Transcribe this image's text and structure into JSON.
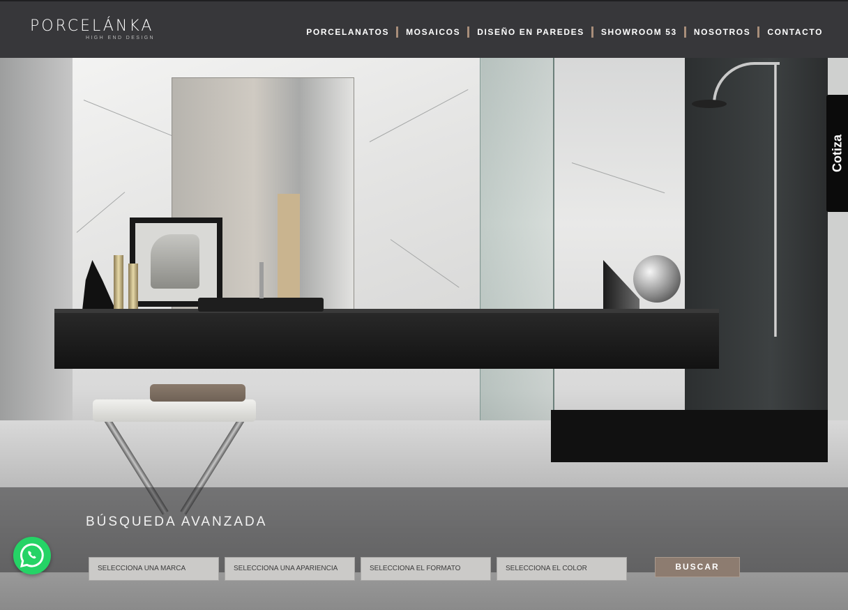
{
  "logo": {
    "name": "PORCELÁNKA",
    "tagline": "HIGH END DESIGN"
  },
  "nav": {
    "items": [
      {
        "label": "PORCELANATOS"
      },
      {
        "label": "MOSAICOS"
      },
      {
        "label": "DISEÑO EN PAREDES"
      },
      {
        "label": "SHOWROOM 53"
      },
      {
        "label": "NOSOTROS"
      },
      {
        "label": "CONTACTO"
      }
    ],
    "separator_color": "#a88e7a"
  },
  "cotiza": {
    "label": "Cotiza"
  },
  "search": {
    "title": "BÚSQUEDA AVANZADA",
    "selects": [
      {
        "label": "SELECCIONA UNA MARCA"
      },
      {
        "label": "SELECCIONA UNA APARIENCIA"
      },
      {
        "label": "SELECCIONA EL FORMATO"
      },
      {
        "label": "SELECCIONA EL COLOR"
      }
    ],
    "button_label": "BUSCAR",
    "button_color": "#8d7c70"
  },
  "icons": {
    "whatsapp": "whatsapp-icon",
    "whatsapp_color": "#25d366"
  }
}
